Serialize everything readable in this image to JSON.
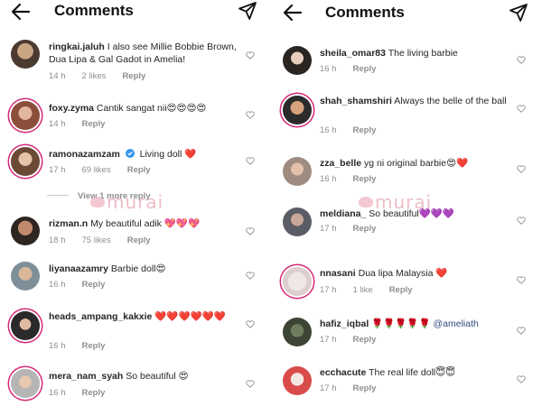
{
  "left": {
    "header": {
      "title": "Comments",
      "back_icon": "back-arrow-icon",
      "send_icon": "paper-plane-icon"
    },
    "comments": [
      {
        "username": "ringkai.jaluh",
        "text": "I also see Millie Bobbie Brown, Dua Lipa & Gal Gadot in Amelia!",
        "time": "14 h",
        "likes": "2 likes",
        "reply": "Reply"
      },
      {
        "username": "foxy.zyma",
        "text": "Cantik sangat nii😍😍😍😍",
        "time": "14 h",
        "likes": "",
        "reply": "Reply"
      },
      {
        "username": "ramonazamzam",
        "text": "Living doll ❤️",
        "time": "17 h",
        "likes": "69 likes",
        "reply": "Reply",
        "verified": true
      },
      {
        "username": "rizman.n",
        "text": "My beautiful adik 💖💖💖",
        "time": "18 h",
        "likes": "75 likes",
        "reply": "Reply"
      },
      {
        "username": "liyanaazamry",
        "text": "Barbie doll😍",
        "time": "16 h",
        "likes": "",
        "reply": "Reply"
      },
      {
        "username": "heads_ampang_kakxie",
        "text": "❤️❤️❤️❤️❤️❤️",
        "time": "16 h",
        "likes": "",
        "reply": "Reply"
      },
      {
        "username": "mera_nam_syah",
        "text": "So beautiful 😍",
        "time": "16 h",
        "likes": "",
        "reply": "Reply"
      }
    ],
    "view_replies": "View 1 more reply",
    "watermark": "murai"
  },
  "right": {
    "header": {
      "title": "Comments",
      "back_icon": "back-arrow-icon",
      "send_icon": "paper-plane-icon"
    },
    "comments": [
      {
        "username": "sheila_omar83",
        "text": "The living barbie",
        "time": "16 h",
        "likes": "",
        "reply": "Reply"
      },
      {
        "username": "shah_shamshiri",
        "text": "Always the belle of the ball",
        "time": "16 h",
        "likes": "",
        "reply": "Reply"
      },
      {
        "username": "zza_belle",
        "text": "yg ni original barbie😍❤️",
        "time": "16 h",
        "likes": "",
        "reply": "Reply"
      },
      {
        "username": "meldiana_",
        "text": "So beautiful💜💜💜",
        "time": "17 h",
        "likes": "",
        "reply": "Reply"
      },
      {
        "username": "nnasani",
        "text": "Dua lipa Malaysia ❤️",
        "time": "17 h",
        "likes": "1 like",
        "reply": "Reply"
      },
      {
        "username": "hafiz_iqbal",
        "text": "🌹🌹🌹🌹🌹",
        "mention": "@ameliath",
        "time": "17 h",
        "likes": "",
        "reply": "Reply"
      },
      {
        "username": "ecchacute",
        "text": "The real life doll😇😇",
        "time": "17 h",
        "likes": "",
        "reply": "Reply"
      }
    ],
    "watermark": "murai"
  },
  "colors": {
    "accent": "#3897f0",
    "meta": "#8e8e8e",
    "story_ring": "#d62976",
    "text": "#262626"
  }
}
